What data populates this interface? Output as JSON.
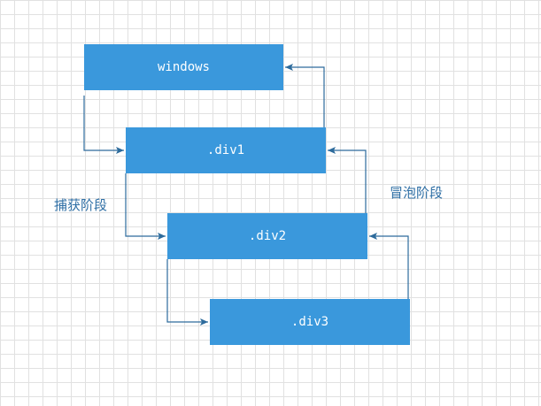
{
  "nodes": {
    "windows": "windows",
    "div1": ".div1",
    "div2": ".div2",
    "div3": ".div3"
  },
  "labels": {
    "capture": "捕获阶段",
    "bubble": "冒泡阶段"
  },
  "colors": {
    "node_fill": "#3a98dc",
    "node_text": "#ffffff",
    "arrow": "#2d6b9c",
    "label_text": "#2f6fa5",
    "grid": "#e1e1e1"
  }
}
